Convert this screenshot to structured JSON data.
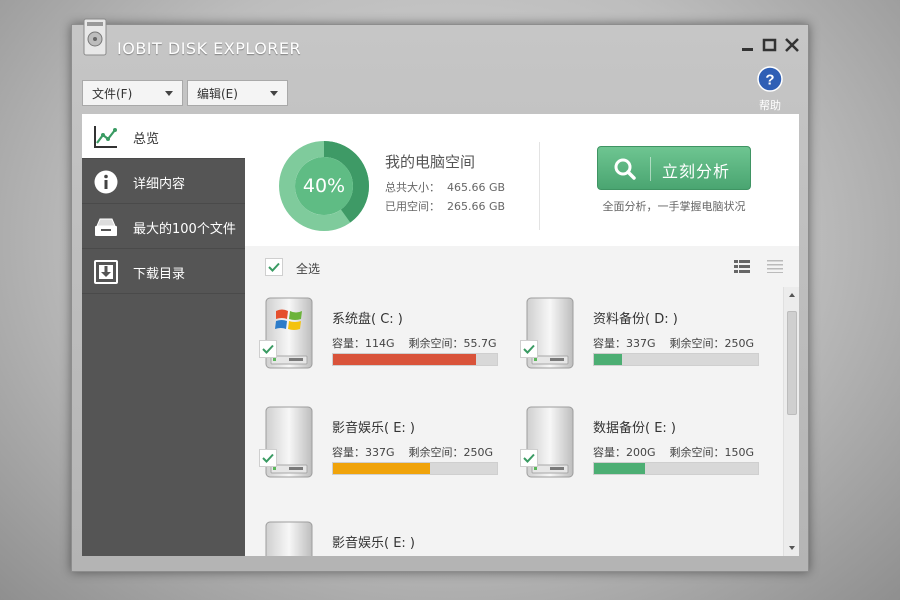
{
  "window": {
    "title": "IOBIT DISK EXPLORER"
  },
  "menus": {
    "file_label": "文件(F)",
    "edit_label": "编辑(E)"
  },
  "help": {
    "label": "帮助"
  },
  "sidebar": {
    "items": [
      {
        "label": "总览",
        "icon": "chart-line-icon",
        "active": true
      },
      {
        "label": "详细内容",
        "icon": "info-icon",
        "active": false
      },
      {
        "label": "最大的100个文件",
        "icon": "drive-tray-icon",
        "active": false
      },
      {
        "label": "下载目录",
        "icon": "download-icon",
        "active": false
      }
    ]
  },
  "summary": {
    "used_percent": 40,
    "used_percent_label": "40%",
    "title": "我的电脑空间",
    "total_label": "总共大小：",
    "total_value": "465.66 GB",
    "used_label": "已用空间：",
    "used_value": "265.66 GB",
    "analyze_label": "立刻分析",
    "analyze_sub": "全面分析，一手掌握电脑状况"
  },
  "toolbar": {
    "select_all_label": "全选"
  },
  "drives": [
    {
      "name": "系统盘( C: )",
      "capacity": "容量：114G",
      "free": "剩余空间：55.7G",
      "used_fraction": 0.87,
      "bar_color": "#d9533a",
      "os_drive": true,
      "checked": true
    },
    {
      "name": "资料备份( D: )",
      "capacity": "容量：337G",
      "free": "剩余空间：250G",
      "used_fraction": 0.17,
      "bar_color": "#4cae73",
      "os_drive": false,
      "checked": true
    },
    {
      "name": "影音娱乐( E: )",
      "capacity": "容量：337G",
      "free": "剩余空间：250G",
      "used_fraction": 0.59,
      "bar_color": "#f0a30a",
      "os_drive": false,
      "checked": true
    },
    {
      "name": "数据备份( E: )",
      "capacity": "容量：200G",
      "free": "剩余空间：150G",
      "used_fraction": 0.31,
      "bar_color": "#4cae73",
      "os_drive": false,
      "checked": true
    },
    {
      "name": "影音娱乐( E: )",
      "capacity": "",
      "free": "",
      "used_fraction": null,
      "bar_color": "",
      "os_drive": false,
      "checked": false
    }
  ],
  "colors": {
    "accent": "#4cae73",
    "sidebar": "#555555",
    "danger": "#d9533a",
    "warning": "#f0a30a"
  }
}
